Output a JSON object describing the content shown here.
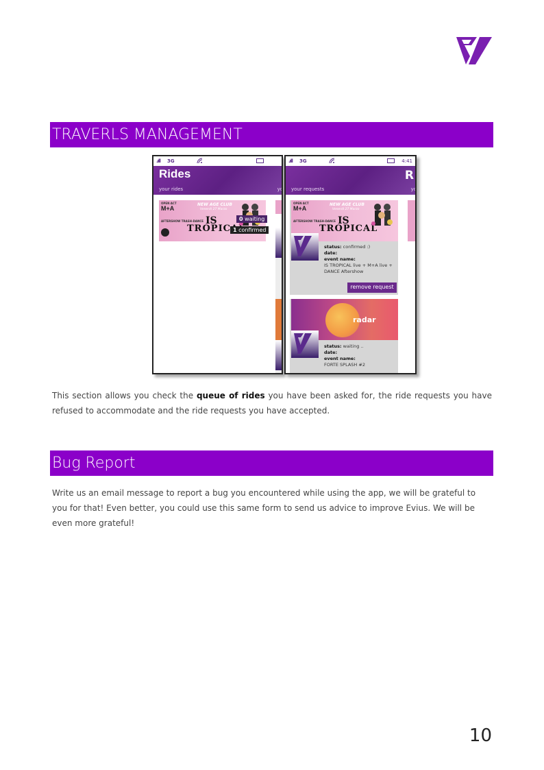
{
  "document": {
    "section1_title": "TRAVERLS MANAGEMENT",
    "section1_text_before": "This section allows you check the ",
    "section1_text_highlight": "queue of rides",
    "section1_text_after": " you have been asked for, the ride requests you have refused to accommodate and the ride requests you have accepted.",
    "section2_title": "Bug Report",
    "section2_text": "Write us an email message to report a bug you encountered while using the app, we will be grateful to you for that! Even better, you could use this same form to send us advice to improve Evius. We will be even more grateful!",
    "page_number": "10",
    "accent_color": "#8b00c9"
  },
  "phone1": {
    "signal": ".ıll",
    "network": "3G",
    "header_title": "Rides",
    "header_subtitle": "your rides",
    "header_subtitle_next": "yo",
    "event": {
      "opening_act": "OPEN ACT",
      "artist": "M+A",
      "club": "NEW AGE CLUB",
      "date": "Venerdì 27 Marzo",
      "aftershow": "AFTERSHOW TRASH-DANCE",
      "title_is": "IS",
      "title_tropical": "TROPICAL"
    },
    "waiting_count": "0",
    "waiting_label": "waiting",
    "confirmed_count": "1",
    "confirmed_label": "confirmed"
  },
  "phone2": {
    "signal": ".ıll",
    "network": "3G",
    "time": "4:41",
    "header_peek": "R",
    "header_subtitle": "your requests",
    "header_subtitle_next": "yo",
    "requests": [
      {
        "status_label": "status:",
        "status_value": " confirmed :)",
        "date_label": "date:",
        "event_label": "event name:",
        "event_value": "IS TROPICAL live + M+A live + DANCE Aftershow",
        "button_label": "remove request"
      },
      {
        "status_label": "status:",
        "status_value": " waiting ..",
        "date_label": "date:",
        "event_label": "event name:",
        "event_value": "FORTE SPLASH #2",
        "banner_text": "radar"
      }
    ]
  }
}
